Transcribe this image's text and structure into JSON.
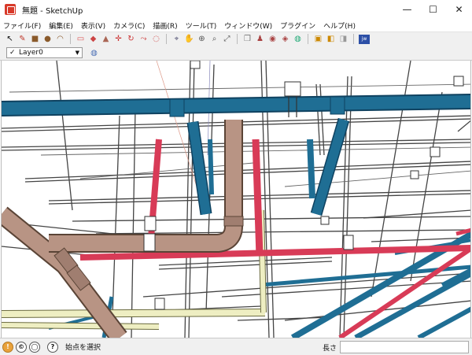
{
  "window": {
    "title": "無題 - SketchUp"
  },
  "window_controls": {
    "minimize": "—",
    "maximize": "☐",
    "close": "✕"
  },
  "menu": [
    "ファイル(F)",
    "編集(E)",
    "表示(V)",
    "カメラ(C)",
    "描画(R)",
    "ツール(T)",
    "ウィンドウ(W)",
    "プラグイン",
    "ヘルプ(H)"
  ],
  "layer": {
    "check": "✓",
    "name": "Layer0",
    "arrow": "▼"
  },
  "toolbar_icons": [
    "select-icon",
    "pencil-icon",
    "rectangle-icon",
    "circle-icon",
    "arc-icon",
    "eraser-icon",
    "paint-bucket-icon",
    "push-pull-icon",
    "move-icon",
    "rotate-icon",
    "follow-me-icon",
    "offset-icon",
    "tape-measure-icon",
    "orbit-icon",
    "pan-icon",
    "zoom-icon",
    "zoom-extents-icon",
    "component-icon",
    "walk-icon",
    "look-around-icon",
    "view-icon",
    "styles-icon",
    "warehouse-icon",
    "extension-icon",
    "jw-icon"
  ],
  "status": {
    "text": "始点を選択",
    "measure_label": "長さ",
    "measure_value": ""
  },
  "colors": {
    "blue_pipe": "#1f6e94",
    "tan_pipe": "#b89484",
    "red_pipe": "#d83b57",
    "yellow_pipe": "#eeeec2",
    "conduit": "#444444"
  }
}
